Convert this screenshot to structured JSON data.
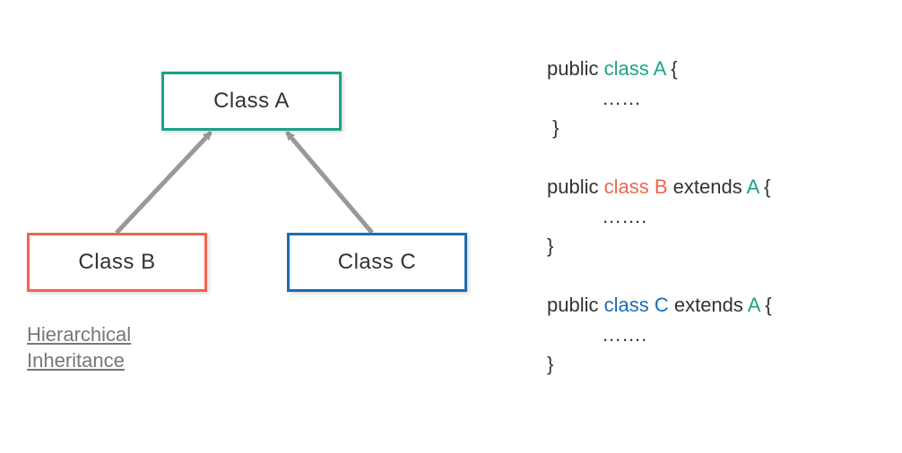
{
  "diagram": {
    "box_a_label": "Class A",
    "box_b_label": "Class B",
    "box_c_label": "Class C",
    "caption_line1": "Hierarchical",
    "caption_line2": "Inheritance",
    "arrows": [
      {
        "from": "Class B",
        "to": "Class A"
      },
      {
        "from": "Class C",
        "to": "Class A"
      }
    ]
  },
  "code": {
    "public": "public ",
    "class_kw": "class ",
    "a_name": "A ",
    "b_name": "B ",
    "c_name": "C ",
    "extends_kw": "extends ",
    "open": "{",
    "close": "}",
    "dots6": "          ……",
    "dots7": "          ……."
  }
}
